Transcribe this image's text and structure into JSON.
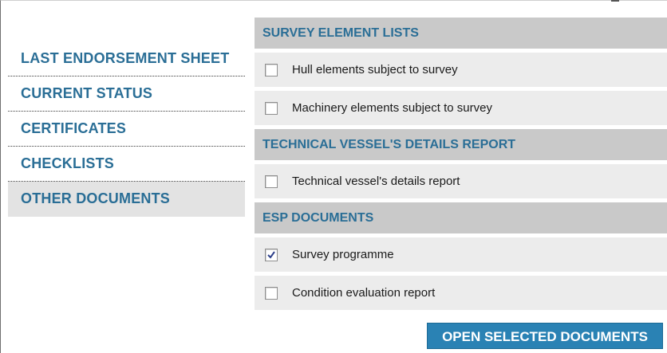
{
  "sidebar": {
    "items": [
      {
        "label": "LAST ENDORSEMENT SHEET"
      },
      {
        "label": "CURRENT STATUS"
      },
      {
        "label": "CERTIFICATES"
      },
      {
        "label": "CHECKLISTS"
      },
      {
        "label": "OTHER DOCUMENTS",
        "active": true
      }
    ]
  },
  "sections": [
    {
      "title": "SURVEY ELEMENT LISTS",
      "rows": [
        {
          "label": "Hull elements subject to survey",
          "checked": false
        },
        {
          "label": "Machinery elements subject to survey",
          "checked": false
        }
      ]
    },
    {
      "title": "TECHNICAL VESSEL'S DETAILS REPORT",
      "rows": [
        {
          "label": "Technical vessel's details report",
          "checked": false
        }
      ]
    },
    {
      "title": "ESP DOCUMENTS",
      "rows": [
        {
          "label": "Survey programme",
          "checked": true
        },
        {
          "label": "Condition evaluation report",
          "checked": false
        }
      ]
    }
  ],
  "actions": {
    "open_label": "OPEN SELECTED DOCUMENTS"
  },
  "colors": {
    "accent_text": "#2a6e96",
    "button_bg": "#2a82b4",
    "header_bg": "#c9c9c9",
    "row_bg": "#ececec",
    "active_item_bg": "#e3e3e3"
  }
}
